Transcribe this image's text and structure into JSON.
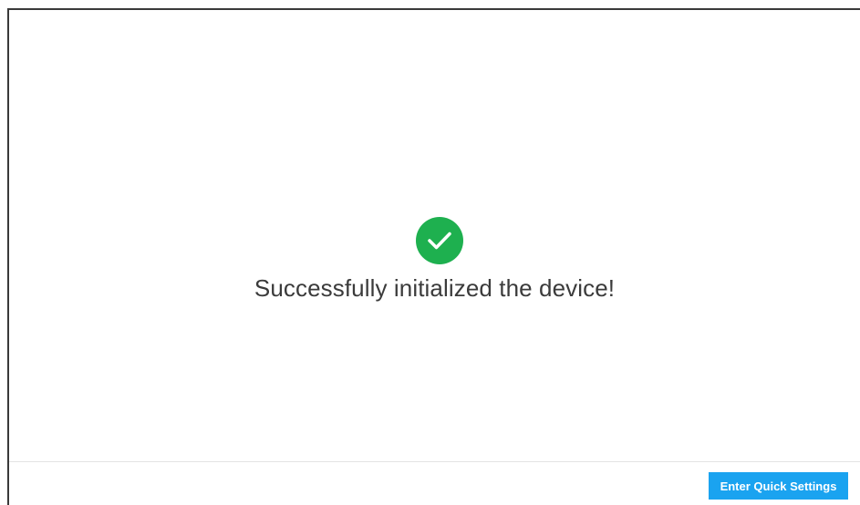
{
  "main": {
    "icon": "check-circle-icon",
    "message": "Successfully initialized the device!"
  },
  "footer": {
    "primary_button_label": "Enter Quick Settings"
  },
  "colors": {
    "success": "#1eb04f",
    "primary": "#1aa3f0",
    "text": "#3b3b3b",
    "border": "#3a3a3a"
  }
}
